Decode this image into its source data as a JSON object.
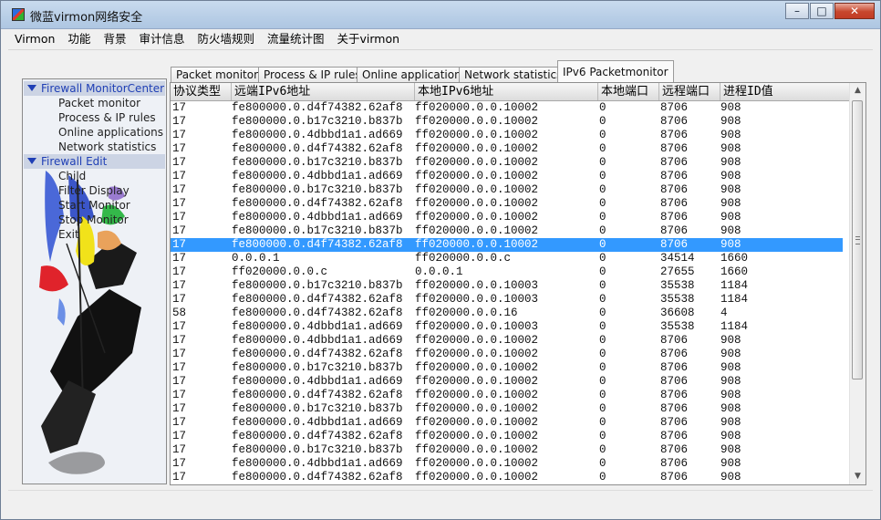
{
  "window": {
    "title": "微蓝virmon网络安全"
  },
  "menubar": {
    "items": [
      "Virmon",
      "功能",
      "背景",
      "审计信息",
      "防火墙规则",
      "流量统计图",
      "关于virmon"
    ]
  },
  "tree": {
    "groups": [
      {
        "label": "Firewall MonitorCenter",
        "items": [
          "Packet monitor",
          "Process & IP rules",
          "Online applications",
          "Network statistics"
        ]
      },
      {
        "label": "Firewall Edit",
        "items": [
          "Child",
          "Filter Display",
          "Start Monitor",
          "Stop Monitor",
          "Exit"
        ]
      }
    ]
  },
  "tabs": [
    "Packet monitor",
    "Process & IP rules",
    "Online applications",
    "Network statistics",
    "IPv6 Packetmonitor"
  ],
  "active_tab": "IPv6 Packetmonitor",
  "table": {
    "columns": [
      "协议类型",
      "远端IPv6地址",
      "本地IPv6地址",
      "本地端口",
      "远程端口",
      "进程ID值"
    ],
    "selected_row": 10,
    "rows": [
      [
        "17",
        "fe800000.0.d4f74382.62af8",
        "ff020000.0.0.10002",
        "0",
        "8706",
        "908"
      ],
      [
        "17",
        "fe800000.0.b17c3210.b837b",
        "ff020000.0.0.10002",
        "0",
        "8706",
        "908"
      ],
      [
        "17",
        "fe800000.0.4dbbd1a1.ad669",
        "ff020000.0.0.10002",
        "0",
        "8706",
        "908"
      ],
      [
        "17",
        "fe800000.0.d4f74382.62af8",
        "ff020000.0.0.10002",
        "0",
        "8706",
        "908"
      ],
      [
        "17",
        "fe800000.0.b17c3210.b837b",
        "ff020000.0.0.10002",
        "0",
        "8706",
        "908"
      ],
      [
        "17",
        "fe800000.0.4dbbd1a1.ad669",
        "ff020000.0.0.10002",
        "0",
        "8706",
        "908"
      ],
      [
        "17",
        "fe800000.0.b17c3210.b837b",
        "ff020000.0.0.10002",
        "0",
        "8706",
        "908"
      ],
      [
        "17",
        "fe800000.0.d4f74382.62af8",
        "ff020000.0.0.10002",
        "0",
        "8706",
        "908"
      ],
      [
        "17",
        "fe800000.0.4dbbd1a1.ad669",
        "ff020000.0.0.10002",
        "0",
        "8706",
        "908"
      ],
      [
        "17",
        "fe800000.0.b17c3210.b837b",
        "ff020000.0.0.10002",
        "0",
        "8706",
        "908"
      ],
      [
        "17",
        "fe800000.0.d4f74382.62af8",
        "ff020000.0.0.10002",
        "0",
        "8706",
        "908"
      ],
      [
        "17",
        "0.0.0.1",
        "ff020000.0.0.c",
        "0",
        "34514",
        "1660"
      ],
      [
        "17",
        "ff020000.0.0.c",
        "0.0.0.1",
        "0",
        "27655",
        "1660"
      ],
      [
        "17",
        "fe800000.0.b17c3210.b837b",
        "ff020000.0.0.10003",
        "0",
        "35538",
        "1184"
      ],
      [
        "17",
        "fe800000.0.d4f74382.62af8",
        "ff020000.0.0.10003",
        "0",
        "35538",
        "1184"
      ],
      [
        "58",
        "fe800000.0.d4f74382.62af8",
        "ff020000.0.0.16",
        "0",
        "36608",
        "4"
      ],
      [
        "17",
        "fe800000.0.4dbbd1a1.ad669",
        "ff020000.0.0.10003",
        "0",
        "35538",
        "1184"
      ],
      [
        "17",
        "fe800000.0.4dbbd1a1.ad669",
        "ff020000.0.0.10002",
        "0",
        "8706",
        "908"
      ],
      [
        "17",
        "fe800000.0.d4f74382.62af8",
        "ff020000.0.0.10002",
        "0",
        "8706",
        "908"
      ],
      [
        "17",
        "fe800000.0.b17c3210.b837b",
        "ff020000.0.0.10002",
        "0",
        "8706",
        "908"
      ],
      [
        "17",
        "fe800000.0.4dbbd1a1.ad669",
        "ff020000.0.0.10002",
        "0",
        "8706",
        "908"
      ],
      [
        "17",
        "fe800000.0.d4f74382.62af8",
        "ff020000.0.0.10002",
        "0",
        "8706",
        "908"
      ],
      [
        "17",
        "fe800000.0.b17c3210.b837b",
        "ff020000.0.0.10002",
        "0",
        "8706",
        "908"
      ],
      [
        "17",
        "fe800000.0.4dbbd1a1.ad669",
        "ff020000.0.0.10002",
        "0",
        "8706",
        "908"
      ],
      [
        "17",
        "fe800000.0.d4f74382.62af8",
        "ff020000.0.0.10002",
        "0",
        "8706",
        "908"
      ],
      [
        "17",
        "fe800000.0.b17c3210.b837b",
        "ff020000.0.0.10002",
        "0",
        "8706",
        "908"
      ],
      [
        "17",
        "fe800000.0.4dbbd1a1.ad669",
        "ff020000.0.0.10002",
        "0",
        "8706",
        "908"
      ],
      [
        "17",
        "fe800000.0.d4f74382.62af8",
        "ff020000.0.0.10002",
        "0",
        "8706",
        "908"
      ]
    ]
  },
  "icons": [
    "app-icon",
    "minimize-icon",
    "maximize-icon",
    "close-icon",
    "collapse-triangle-icon",
    "scroll-up-icon",
    "scroll-down-icon"
  ],
  "colors": {
    "selection": "#3399ff",
    "tree_group_text": "#1f3fb5",
    "tree_group_bg": "#ccd4e4"
  }
}
